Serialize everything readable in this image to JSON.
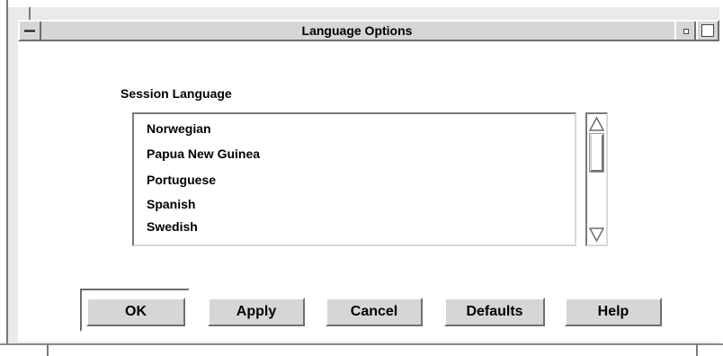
{
  "window": {
    "title": "Language Options"
  },
  "titlebar": {
    "menu_icon": "window-menu-icon",
    "minimize_icon": "minimize-icon",
    "maximize_icon": "maximize-icon"
  },
  "session": {
    "label": "Session Language",
    "languages": [
      "Norwegian",
      "Papua New Guinea",
      "Portuguese",
      "Spanish",
      "Swedish"
    ]
  },
  "scrollbar": {
    "up_icon": "scroll-up-arrow-icon",
    "down_icon": "scroll-down-arrow-icon"
  },
  "buttons": {
    "ok": "OK",
    "apply": "Apply",
    "cancel": "Cancel",
    "defaults": "Defaults",
    "help": "Help"
  },
  "colors": {
    "frame": "#d6d6d6",
    "shadow": "#6e6e6e",
    "highlight": "#ffffff"
  }
}
